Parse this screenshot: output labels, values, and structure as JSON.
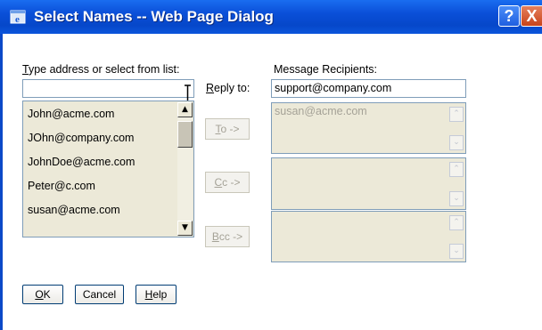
{
  "window": {
    "title": "Select Names -- Web Page Dialog",
    "title_icon": "ie-dialog-icon",
    "help_label": "?",
    "close_label": "X",
    "titlebar_color": "#0a4fd8"
  },
  "left": {
    "label": "Type address or select from list:",
    "label_accel": "T",
    "label_rest": "ype address or select from list:",
    "search_value": "",
    "list": [
      "John@acme.com",
      "JOhn@company.com",
      "JohnDoe@acme.com",
      "Peter@c.com",
      "susan@acme.com"
    ]
  },
  "reply": {
    "label_accel": "R",
    "label_rest": "eply to:",
    "value": "support@company.com"
  },
  "right": {
    "label": "Message Recipients:",
    "to_recipients": "susan@acme.com",
    "cc_recipients": "",
    "bcc_recipients": ""
  },
  "buttons": {
    "to_accel": "T",
    "to_rest": "o ->",
    "cc_accel": "C",
    "cc_rest": "c ->",
    "bcc_accel": "B",
    "bcc_rest": "cc ->",
    "ok_accel": "O",
    "ok_rest": "K",
    "cancel_label": "Cancel",
    "help_accel": "H",
    "help_rest": "elp"
  }
}
